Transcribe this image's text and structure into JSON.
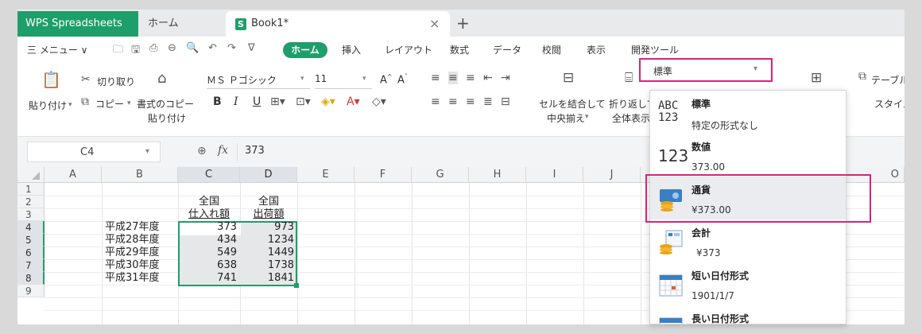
{
  "titlebar": {
    "app_tab": "WPS Spreadsheets",
    "home_tab": "ホーム",
    "book_tab": "Book1*",
    "close": "×",
    "new_tab": "+"
  },
  "menu": {
    "main_menu": "三 メニュー ∨",
    "quick": [
      "🗀",
      "🖫",
      "⎙",
      "⊖",
      "🔍",
      "↶",
      "↷",
      "∇"
    ],
    "tabs": [
      "ホーム",
      "挿入",
      "レイアウト",
      "数式",
      "データ",
      "校閲",
      "表示",
      "開発ツール"
    ]
  },
  "ribbon": {
    "paste": "貼り付け",
    "cut": "切り取り",
    "copy": "コピー",
    "format_paste_1": "書式のコピー",
    "format_paste_2": "貼り付け",
    "font_name": "ＭＳ Ｐゴシック",
    "font_size": "11",
    "merge_1": "セルを結合して",
    "merge_2": "中央揃え",
    "wrap_1": "折り返して",
    "wrap_2": "全体表示",
    "number_format": "標準",
    "table_label": "テーブル",
    "style_label": "スタイル",
    "bold": "B",
    "italic": "I",
    "underline": "U"
  },
  "formula_bar": {
    "cell_ref": "C4",
    "fx": "fx",
    "value": "373"
  },
  "grid": {
    "columns": [
      "A",
      "B",
      "C",
      "D",
      "E",
      "F",
      "G",
      "H",
      "I",
      "J",
      "O"
    ],
    "rows": [
      "1",
      "2",
      "3",
      "4",
      "5",
      "6",
      "7",
      "8",
      "9"
    ],
    "header_c_1": "全国",
    "header_c_2": "仕入れ額",
    "header_d_1": "全国",
    "header_d_2": "出荷額",
    "data": [
      {
        "label": "平成27年度",
        "c": "373",
        "d": "973"
      },
      {
        "label": "平成28年度",
        "c": "434",
        "d": "1234"
      },
      {
        "label": "平成29年度",
        "c": "549",
        "d": "1449"
      },
      {
        "label": "平成30年度",
        "c": "638",
        "d": "1738"
      },
      {
        "label": "平成31年度",
        "c": "741",
        "d": "1841"
      }
    ]
  },
  "number_format_dropdown": {
    "items": [
      {
        "name": "標準",
        "example": "特定の形式なし",
        "icon": "abc-123-icon",
        "icon_text_1": "ABC",
        "icon_text_2": "123"
      },
      {
        "name": "数値",
        "example": "373.00",
        "icon": "number-icon",
        "icon_text_1": "123"
      },
      {
        "name": "通貨",
        "example": "¥373.00",
        "icon": "currency-icon"
      },
      {
        "name": "会計",
        "example": "¥373",
        "icon": "accounting-icon"
      },
      {
        "name": "短い日付形式",
        "example": "1901/1/7",
        "icon": "calendar-icon"
      },
      {
        "name": "長い日付形式",
        "example": "",
        "icon": "calendar-icon"
      }
    ],
    "selected_index": 2
  },
  "colors": {
    "accent": "#1e9e6a",
    "highlight": "#d6247a"
  }
}
